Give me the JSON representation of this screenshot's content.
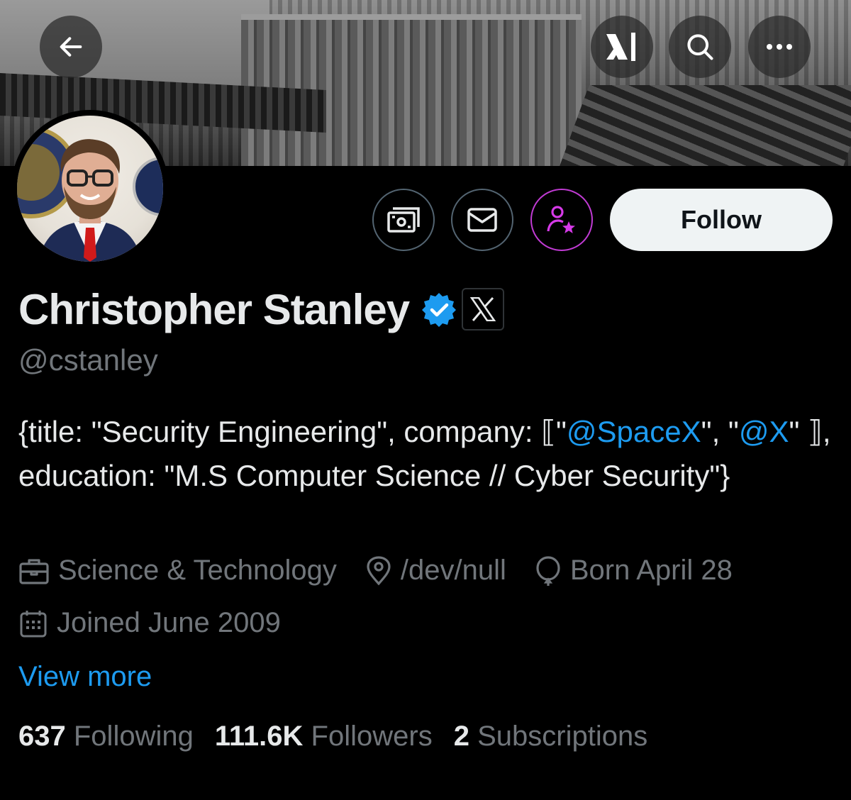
{
  "header": {
    "back_icon": "arrow-left-icon",
    "xai_icon": "xai-logo-icon",
    "search_icon": "search-icon",
    "more_icon": "more-horizontal-icon"
  },
  "profile": {
    "name": "Christopher Stanley",
    "handle": "@cstanley",
    "verified": true,
    "affiliation_icon": "x-logo-icon"
  },
  "actions": {
    "tip_icon": "money-icon",
    "message_icon": "envelope-icon",
    "subscribe_icon": "person-star-icon",
    "follow_label": "Follow"
  },
  "bio": {
    "part1": "{title: \"Security Engineering\", company: ⟦\"",
    "mention1": "@SpaceX",
    "part2": "\", \"",
    "mention2": "@X",
    "part3": "\" ⟧, education: \"M.S Computer Science // Cyber Security\"}"
  },
  "meta": {
    "category": "Science & Technology",
    "location": "/dev/null",
    "birthday": "Born April 28",
    "joined": "Joined June 2009"
  },
  "view_more": "View more",
  "stats": {
    "following_count": "637",
    "following_label": "Following",
    "followers_count": "111.6K",
    "followers_label": "Followers",
    "subscriptions_count": "2",
    "subscriptions_label": "Subscriptions"
  },
  "colors": {
    "accent": "#1d9bf0",
    "subscribe_ring": "#c13bd4",
    "muted": "#71767b",
    "text": "#e7e9ea"
  }
}
